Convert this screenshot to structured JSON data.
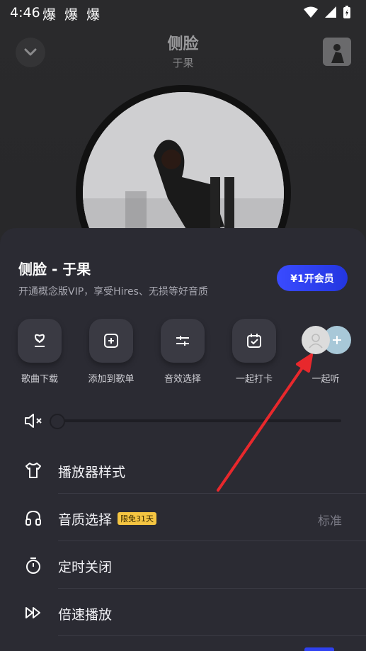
{
  "status_bar": {
    "time": "4:46",
    "notifications": [
      "爆",
      "爆",
      "爆"
    ]
  },
  "player": {
    "title": "侧脸",
    "artist": "于果"
  },
  "sheet": {
    "title": "侧脸 - 于果",
    "subtitle": "开通概念版VIP，享受Hires、无损等好音质",
    "vip_button": "¥1开会员",
    "actions": [
      {
        "label": "歌曲下载",
        "icon": "download-icon"
      },
      {
        "label": "添加到歌单",
        "icon": "add-to-playlist-icon"
      },
      {
        "label": "音效选择",
        "icon": "sound-effect-icon"
      },
      {
        "label": "一起打卡",
        "icon": "check-in-icon"
      }
    ],
    "together_label": "一起听",
    "volume": 0.0,
    "menu": [
      {
        "label": "播放器样式",
        "icon": "shirt-icon"
      },
      {
        "label": "音质选择",
        "icon": "headphones-icon",
        "badge": "限免31天",
        "value": "标准"
      },
      {
        "label": "定时关闭",
        "icon": "timer-icon"
      },
      {
        "label": "倍速播放",
        "icon": "speed-icon"
      }
    ]
  },
  "colors": {
    "accent": "#2f41f0",
    "badge": "#f5c542",
    "annotation_arrow": "#e8282c"
  }
}
